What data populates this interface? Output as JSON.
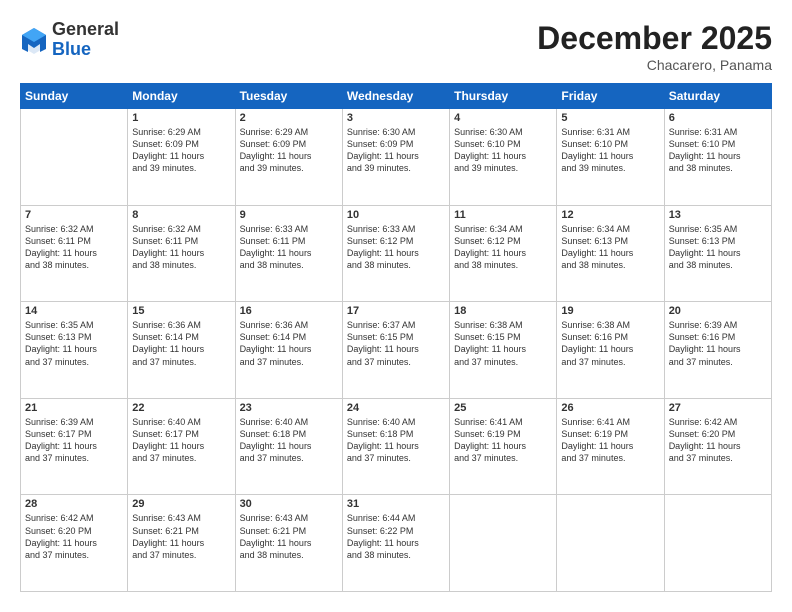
{
  "header": {
    "logo_general": "General",
    "logo_blue": "Blue",
    "month": "December 2025",
    "location": "Chacarero, Panama"
  },
  "days_of_week": [
    "Sunday",
    "Monday",
    "Tuesday",
    "Wednesday",
    "Thursday",
    "Friday",
    "Saturday"
  ],
  "weeks": [
    [
      {
        "day": "",
        "info": ""
      },
      {
        "day": "1",
        "info": "Sunrise: 6:29 AM\nSunset: 6:09 PM\nDaylight: 11 hours\nand 39 minutes."
      },
      {
        "day": "2",
        "info": "Sunrise: 6:29 AM\nSunset: 6:09 PM\nDaylight: 11 hours\nand 39 minutes."
      },
      {
        "day": "3",
        "info": "Sunrise: 6:30 AM\nSunset: 6:09 PM\nDaylight: 11 hours\nand 39 minutes."
      },
      {
        "day": "4",
        "info": "Sunrise: 6:30 AM\nSunset: 6:10 PM\nDaylight: 11 hours\nand 39 minutes."
      },
      {
        "day": "5",
        "info": "Sunrise: 6:31 AM\nSunset: 6:10 PM\nDaylight: 11 hours\nand 39 minutes."
      },
      {
        "day": "6",
        "info": "Sunrise: 6:31 AM\nSunset: 6:10 PM\nDaylight: 11 hours\nand 38 minutes."
      }
    ],
    [
      {
        "day": "7",
        "info": "Sunrise: 6:32 AM\nSunset: 6:11 PM\nDaylight: 11 hours\nand 38 minutes."
      },
      {
        "day": "8",
        "info": "Sunrise: 6:32 AM\nSunset: 6:11 PM\nDaylight: 11 hours\nand 38 minutes."
      },
      {
        "day": "9",
        "info": "Sunrise: 6:33 AM\nSunset: 6:11 PM\nDaylight: 11 hours\nand 38 minutes."
      },
      {
        "day": "10",
        "info": "Sunrise: 6:33 AM\nSunset: 6:12 PM\nDaylight: 11 hours\nand 38 minutes."
      },
      {
        "day": "11",
        "info": "Sunrise: 6:34 AM\nSunset: 6:12 PM\nDaylight: 11 hours\nand 38 minutes."
      },
      {
        "day": "12",
        "info": "Sunrise: 6:34 AM\nSunset: 6:13 PM\nDaylight: 11 hours\nand 38 minutes."
      },
      {
        "day": "13",
        "info": "Sunrise: 6:35 AM\nSunset: 6:13 PM\nDaylight: 11 hours\nand 38 minutes."
      }
    ],
    [
      {
        "day": "14",
        "info": "Sunrise: 6:35 AM\nSunset: 6:13 PM\nDaylight: 11 hours\nand 37 minutes."
      },
      {
        "day": "15",
        "info": "Sunrise: 6:36 AM\nSunset: 6:14 PM\nDaylight: 11 hours\nand 37 minutes."
      },
      {
        "day": "16",
        "info": "Sunrise: 6:36 AM\nSunset: 6:14 PM\nDaylight: 11 hours\nand 37 minutes."
      },
      {
        "day": "17",
        "info": "Sunrise: 6:37 AM\nSunset: 6:15 PM\nDaylight: 11 hours\nand 37 minutes."
      },
      {
        "day": "18",
        "info": "Sunrise: 6:38 AM\nSunset: 6:15 PM\nDaylight: 11 hours\nand 37 minutes."
      },
      {
        "day": "19",
        "info": "Sunrise: 6:38 AM\nSunset: 6:16 PM\nDaylight: 11 hours\nand 37 minutes."
      },
      {
        "day": "20",
        "info": "Sunrise: 6:39 AM\nSunset: 6:16 PM\nDaylight: 11 hours\nand 37 minutes."
      }
    ],
    [
      {
        "day": "21",
        "info": "Sunrise: 6:39 AM\nSunset: 6:17 PM\nDaylight: 11 hours\nand 37 minutes."
      },
      {
        "day": "22",
        "info": "Sunrise: 6:40 AM\nSunset: 6:17 PM\nDaylight: 11 hours\nand 37 minutes."
      },
      {
        "day": "23",
        "info": "Sunrise: 6:40 AM\nSunset: 6:18 PM\nDaylight: 11 hours\nand 37 minutes."
      },
      {
        "day": "24",
        "info": "Sunrise: 6:40 AM\nSunset: 6:18 PM\nDaylight: 11 hours\nand 37 minutes."
      },
      {
        "day": "25",
        "info": "Sunrise: 6:41 AM\nSunset: 6:19 PM\nDaylight: 11 hours\nand 37 minutes."
      },
      {
        "day": "26",
        "info": "Sunrise: 6:41 AM\nSunset: 6:19 PM\nDaylight: 11 hours\nand 37 minutes."
      },
      {
        "day": "27",
        "info": "Sunrise: 6:42 AM\nSunset: 6:20 PM\nDaylight: 11 hours\nand 37 minutes."
      }
    ],
    [
      {
        "day": "28",
        "info": "Sunrise: 6:42 AM\nSunset: 6:20 PM\nDaylight: 11 hours\nand 37 minutes."
      },
      {
        "day": "29",
        "info": "Sunrise: 6:43 AM\nSunset: 6:21 PM\nDaylight: 11 hours\nand 37 minutes."
      },
      {
        "day": "30",
        "info": "Sunrise: 6:43 AM\nSunset: 6:21 PM\nDaylight: 11 hours\nand 38 minutes."
      },
      {
        "day": "31",
        "info": "Sunrise: 6:44 AM\nSunset: 6:22 PM\nDaylight: 11 hours\nand 38 minutes."
      },
      {
        "day": "",
        "info": ""
      },
      {
        "day": "",
        "info": ""
      },
      {
        "day": "",
        "info": ""
      }
    ]
  ]
}
